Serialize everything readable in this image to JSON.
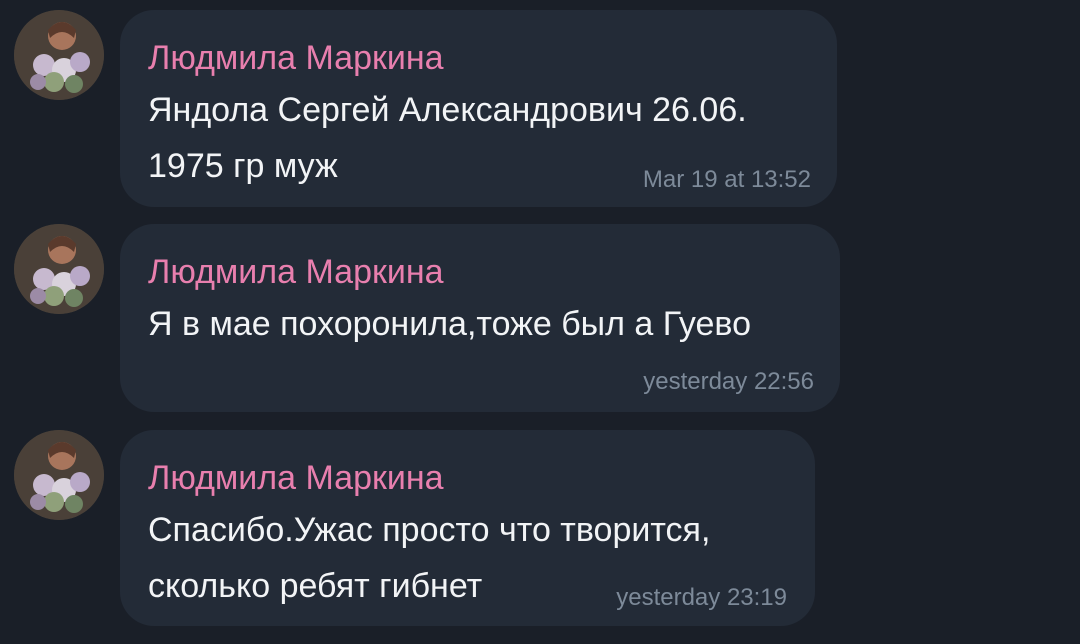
{
  "colors": {
    "background": "#1a1f28",
    "bubble": "#232b37",
    "sender_name": "#e87fae",
    "message_text": "#f2f4f6",
    "timestamp": "#7d8a99"
  },
  "messages": [
    {
      "sender": "Людмила Маркина",
      "avatar_icon": "user-avatar-flowers",
      "text": "Яндола Сергей Александрович 26.06.\n1975 гр муж",
      "time": "Mar 19 at 13:52"
    },
    {
      "sender": "Людмила Маркина",
      "avatar_icon": "user-avatar-flowers",
      "text": "Я в мае похоронила,тоже был а Гуево",
      "time": "yesterday 22:56"
    },
    {
      "sender": "Людмила Маркина",
      "avatar_icon": "user-avatar-flowers",
      "text": "Спасибо.Ужас просто что творится,\nсколько ребят гибнет",
      "time": "yesterday 23:19"
    }
  ]
}
